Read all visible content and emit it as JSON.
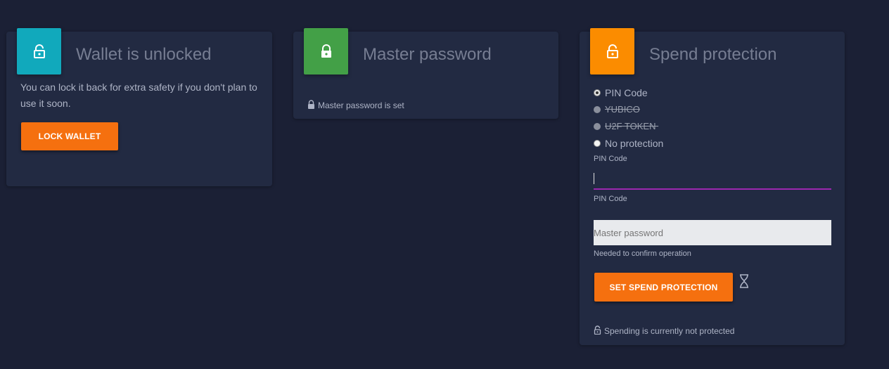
{
  "wallet_card": {
    "icon": "lock-open-icon",
    "title": "Wallet is unlocked",
    "description": "You can lock it back for extra safety if you don't plan to use it soon.",
    "lock_button": "LOCK WALLET",
    "icon_color": "#11a9bc"
  },
  "master_card": {
    "icon": "lock-icon",
    "title": "Master password",
    "status": "Master password is set",
    "icon_color": "#43a047"
  },
  "spend_card": {
    "icon": "lock-open-icon",
    "title": "Spend protection",
    "icon_color": "#fb8c00",
    "options": [
      {
        "label": "PIN Code",
        "state": "selected"
      },
      {
        "label": "YUBICO",
        "state": "disabled"
      },
      {
        "label": "U2F TOKEN ",
        "state": "disabled"
      },
      {
        "label": "No protection",
        "state": "unselected"
      }
    ],
    "pin_label": "PIN Code",
    "pin_value": "",
    "pin_helper": "PIN Code",
    "master_placeholder": "Master password",
    "master_helper": "Needed to confirm operation",
    "submit_button": "SET SPEND PROTECTION",
    "status": "Spending is currently not protected",
    "accent": "#9c27b0"
  }
}
